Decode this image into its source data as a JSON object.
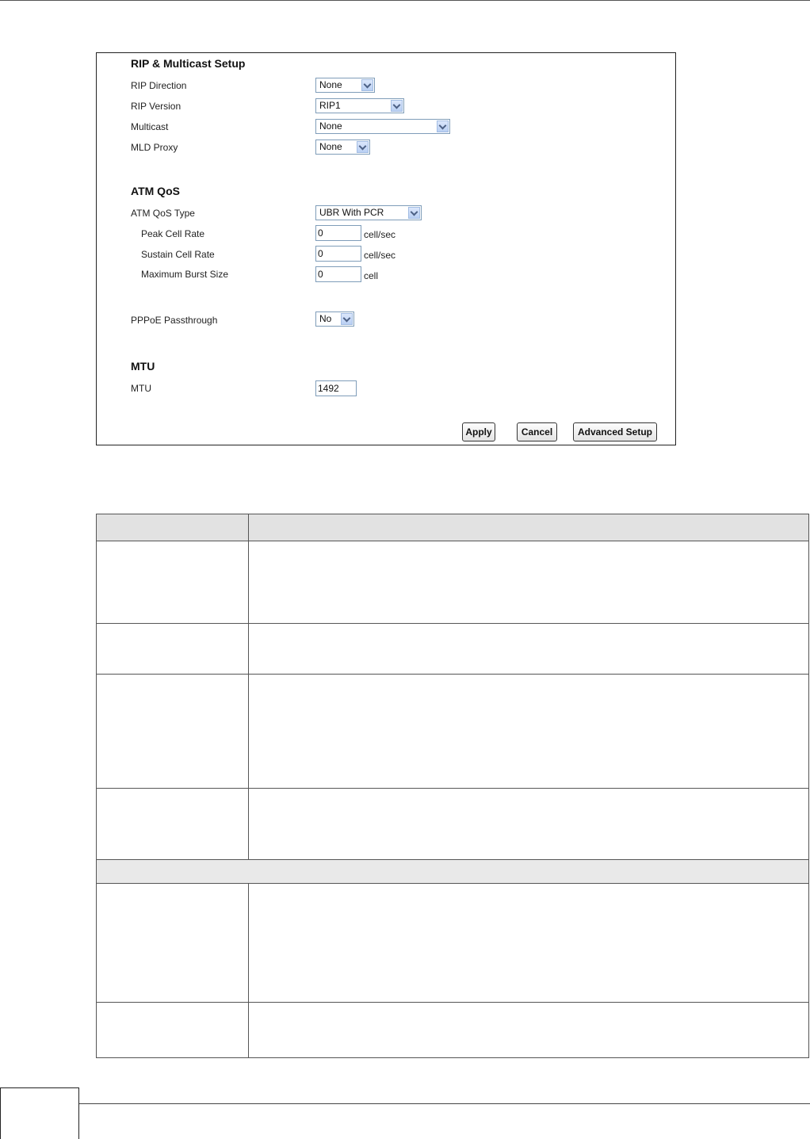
{
  "rip_multicast": {
    "title": "RIP & Multicast Setup",
    "rip_direction": {
      "label": "RIP Direction",
      "value": "None"
    },
    "rip_version": {
      "label": "RIP Version",
      "value": "RIP1"
    },
    "multicast": {
      "label": "Multicast",
      "value": "None"
    },
    "mld_proxy": {
      "label": "MLD Proxy",
      "value": "None"
    }
  },
  "atm_qos": {
    "title": "ATM QoS",
    "type": {
      "label": "ATM QoS Type",
      "value": "UBR With PCR"
    },
    "peak_cell_rate": {
      "label": "Peak Cell Rate",
      "value": "0",
      "unit": "cell/sec"
    },
    "sustain_cell_rate": {
      "label": "Sustain Cell Rate",
      "value": "0",
      "unit": "cell/sec"
    },
    "max_burst_size": {
      "label": "Maximum Burst Size",
      "value": "0",
      "unit": "cell"
    }
  },
  "pppoe": {
    "label": "PPPoE Passthrough",
    "value": "No"
  },
  "mtu": {
    "title": "MTU",
    "label": "MTU",
    "value": "1492"
  },
  "buttons": {
    "apply": "Apply",
    "cancel": "Cancel",
    "advanced": "Advanced Setup"
  }
}
